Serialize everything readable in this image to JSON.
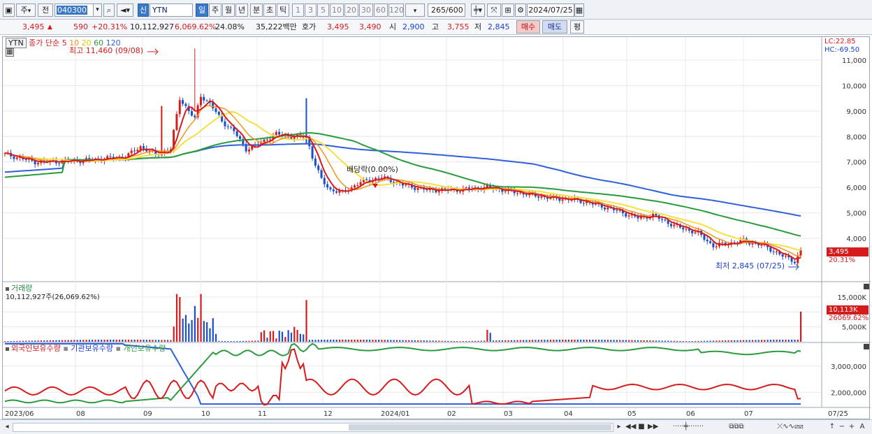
{
  "toolbar": {
    "period_items": [
      "주",
      "전"
    ],
    "stock_code": "040300",
    "market_badge": "신",
    "stock_name": "YTN",
    "periods": [
      "일",
      "주",
      "월",
      "년",
      "분",
      "초",
      "틱"
    ],
    "intervals": [
      "1",
      "3",
      "5",
      "10",
      "20",
      "30",
      "60",
      "120"
    ],
    "count_value": "265",
    "count_total": "/600",
    "date": "2024/07/25"
  },
  "quote": {
    "price": "3,495",
    "up_arrow": "▲",
    "change": "590",
    "change_pct": "+20.31%",
    "volume": "10,112,927",
    "volume_ratio": "6,069.62%",
    "turnover": "24.08%",
    "amount": "35,222백만",
    "ask_label": "호가",
    "ask": "3,495",
    "bid": "3,490",
    "open_label": "시",
    "open": "2,900",
    "high_label": "고",
    "high": "3,755",
    "low_label": "저",
    "low": "2,845",
    "buy_label": "매수",
    "sell_label": "매도",
    "avg_label": "평"
  },
  "price_pane": {
    "tag": "YTN",
    "legend_main": "종가 단순 5",
    "ma_labels": [
      "10",
      "20",
      "60",
      "120"
    ],
    "high_note": "최고 11,460 (09/08)",
    "low_note": "최저 2,845 (07/25)",
    "event_note": "배당락(0.00%)",
    "lc_label": "LC:22.85",
    "hc_label": "HC:-69.50",
    "y_ticks": [
      "11,000",
      "10,000",
      "9,000",
      "8,000",
      "7,000",
      "6,000",
      "5,000",
      "4,000"
    ],
    "last_price_tag": "3,495",
    "last_pct_tag": "20.31%"
  },
  "volume_pane": {
    "title": "거래량",
    "value_text": "10,112,927주(26,069.62%)",
    "y_ticks": [
      "15,000K",
      "10,000K",
      "5,000K"
    ],
    "last_tag": "10,113K",
    "last_pct": "26069.62%"
  },
  "holding_pane": {
    "legend": [
      "외국인보유수량",
      "기관보유수량",
      "개인보유수량"
    ],
    "y_ticks": [
      "3,000,000",
      "2,000,000"
    ]
  },
  "x_axis": [
    "2023/06",
    "08",
    "09",
    "10",
    "11",
    "12",
    "2024/01",
    "02",
    "03",
    "04",
    "05",
    "06",
    "07",
    "07/25"
  ],
  "colors": {
    "up": "#d51b1b",
    "down": "#1a4fc9",
    "ma5": "#d51b1b",
    "ma10": "#f0941e",
    "ma20": "#f5e042",
    "ma60": "#2a9a3c",
    "ma120": "#2f5fd9",
    "foreign": "#d51b1b",
    "institution": "#2f5fd9",
    "individual": "#2a9a3c"
  }
}
